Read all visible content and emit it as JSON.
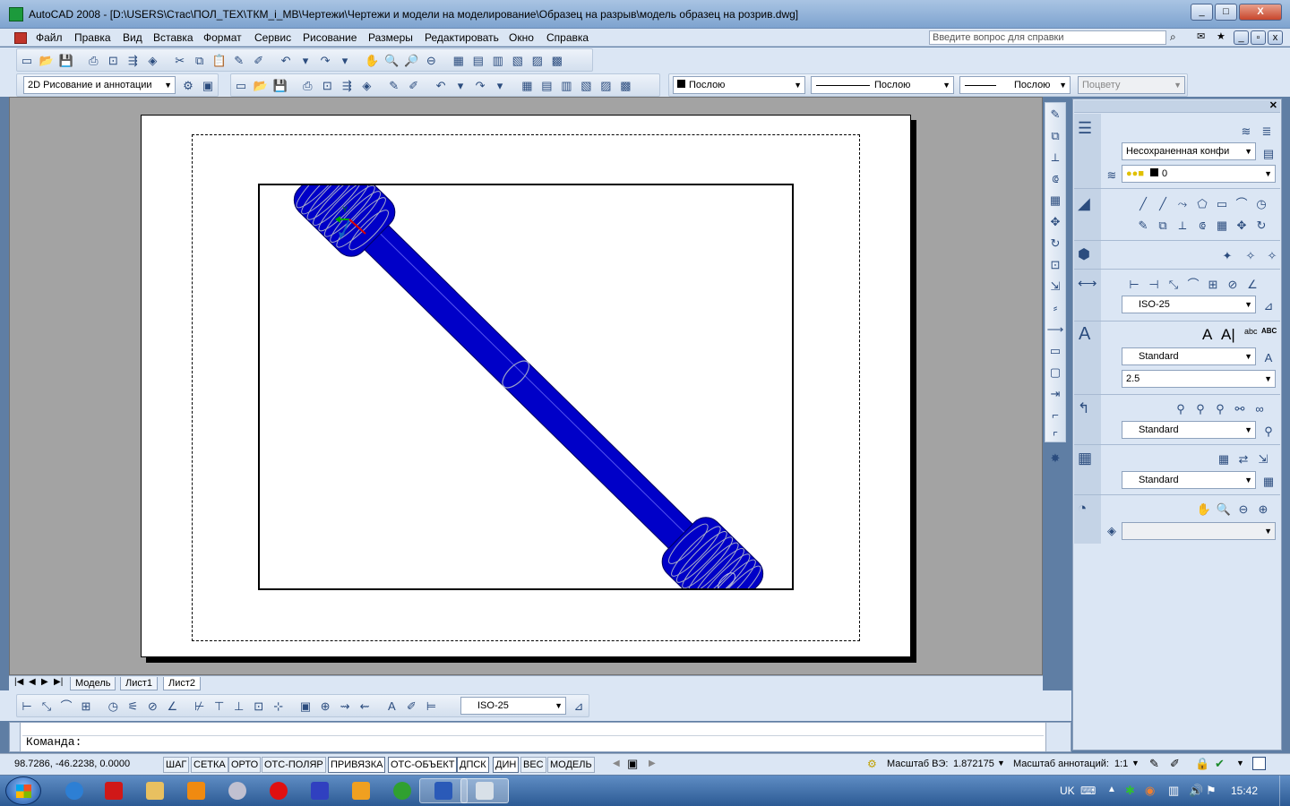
{
  "window": {
    "title": "AutoCAD 2008 - [D:\\USERS\\Стас\\ПОЛ_ТЕХ\\ТКМ_i_МВ\\Чертежи\\Чертежи и модели на моделирование\\Образец на разрыв\\модель образец на розрив.dwg]",
    "min": "_",
    "max": "□",
    "close": "X"
  },
  "menu": {
    "items": [
      "Файл",
      "Правка",
      "Вид",
      "Вставка",
      "Формат",
      "Сервис",
      "Рисование",
      "Размеры",
      "Редактировать",
      "Окно",
      "Справка"
    ],
    "help_placeholder": "Введите вопрос для справки"
  },
  "toolbar2": {
    "workspace": "2D Рисование и аннотации",
    "color": "Послою",
    "linetype": "Послою",
    "lineweight": "Послою",
    "plotstyle": "Поцвету"
  },
  "ucs": {
    "y_label": "Y"
  },
  "tabs": [
    "Модель",
    "Лист1",
    "Лист2"
  ],
  "dimtoolbar": {
    "style": "ISO-25"
  },
  "palette": {
    "layer_state": "Несохраненная конфи",
    "layer_name": "0",
    "dim_style": "ISO-25",
    "text_style": "Standard",
    "text_height": "2.5",
    "mleader_style": "Standard",
    "table_style": "Standard",
    "text_btn": "A",
    "text_btn2": "A|",
    "abc": "ABC",
    "abc2": "abc"
  },
  "command": {
    "prompt": "Команда:"
  },
  "status": {
    "coords": "98.7286, -46.2238, 0.0000",
    "toggles": [
      "ШАГ",
      "СЕТКА",
      "ОРТО",
      "ОТС-ПОЛЯР",
      "ПРИВЯЗКА",
      "ОТС-ОБЪЕКТ",
      "ДПСК",
      "ДИН",
      "ВЕС",
      "МОДЕЛЬ"
    ],
    "vs_scale_label": "Масштаб ВЭ:",
    "vs_scale_value": "1.872175",
    "anno_label": "Масштаб аннотаций:",
    "anno_value": "1:1"
  },
  "tray": {
    "lang": "UK",
    "time": "15:42"
  },
  "colors": {
    "model": "#0000c8",
    "accent": "#2b4c7e"
  }
}
